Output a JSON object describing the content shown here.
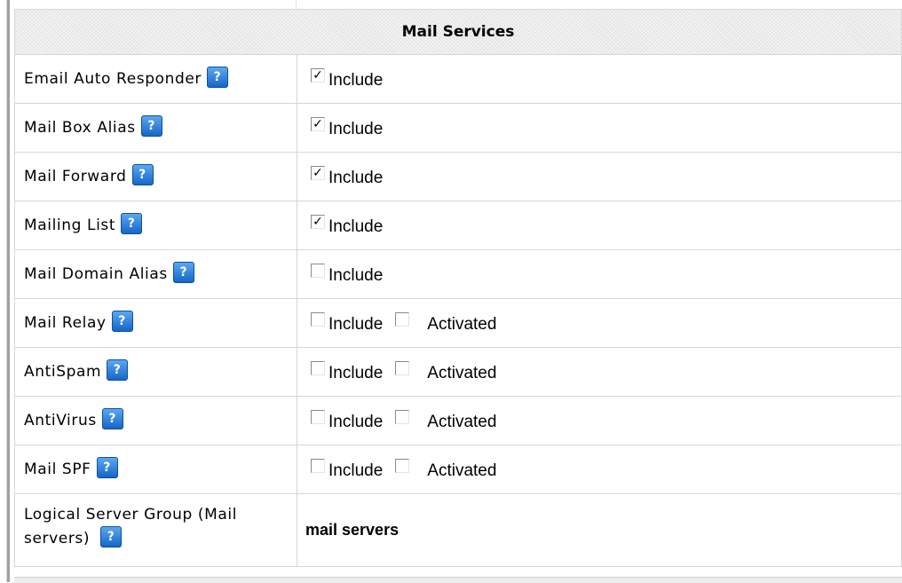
{
  "section_title": "Mail Services",
  "help_glyph": "?",
  "check_glyph": "✓",
  "rows": [
    {
      "label": "Email Auto Responder",
      "include_label": "Include",
      "include_checked": true
    },
    {
      "label": "Mail Box Alias",
      "include_label": "Include",
      "include_checked": true
    },
    {
      "label": "Mail Forward",
      "include_label": "Include",
      "include_checked": true
    },
    {
      "label": "Mailing List",
      "include_label": "Include",
      "include_checked": true
    },
    {
      "label": "Mail Domain Alias",
      "include_label": "Include",
      "include_checked": false
    },
    {
      "label": "Mail Relay",
      "include_label": "Include",
      "include_checked": false,
      "activated_label": "Activated",
      "activated_checked": false
    },
    {
      "label": "AntiSpam",
      "include_label": "Include",
      "include_checked": false,
      "activated_label": "Activated",
      "activated_checked": false
    },
    {
      "label": "AntiVirus",
      "include_label": "Include",
      "include_checked": false,
      "activated_label": "Activated",
      "activated_checked": false
    },
    {
      "label": "Mail SPF",
      "include_label": "Include",
      "include_checked": false,
      "activated_label": "Activated",
      "activated_checked": false
    }
  ],
  "server_group": {
    "label_line1": "Logical Server Group (Mail",
    "label_line2": "servers)",
    "value": "mail servers"
  }
}
